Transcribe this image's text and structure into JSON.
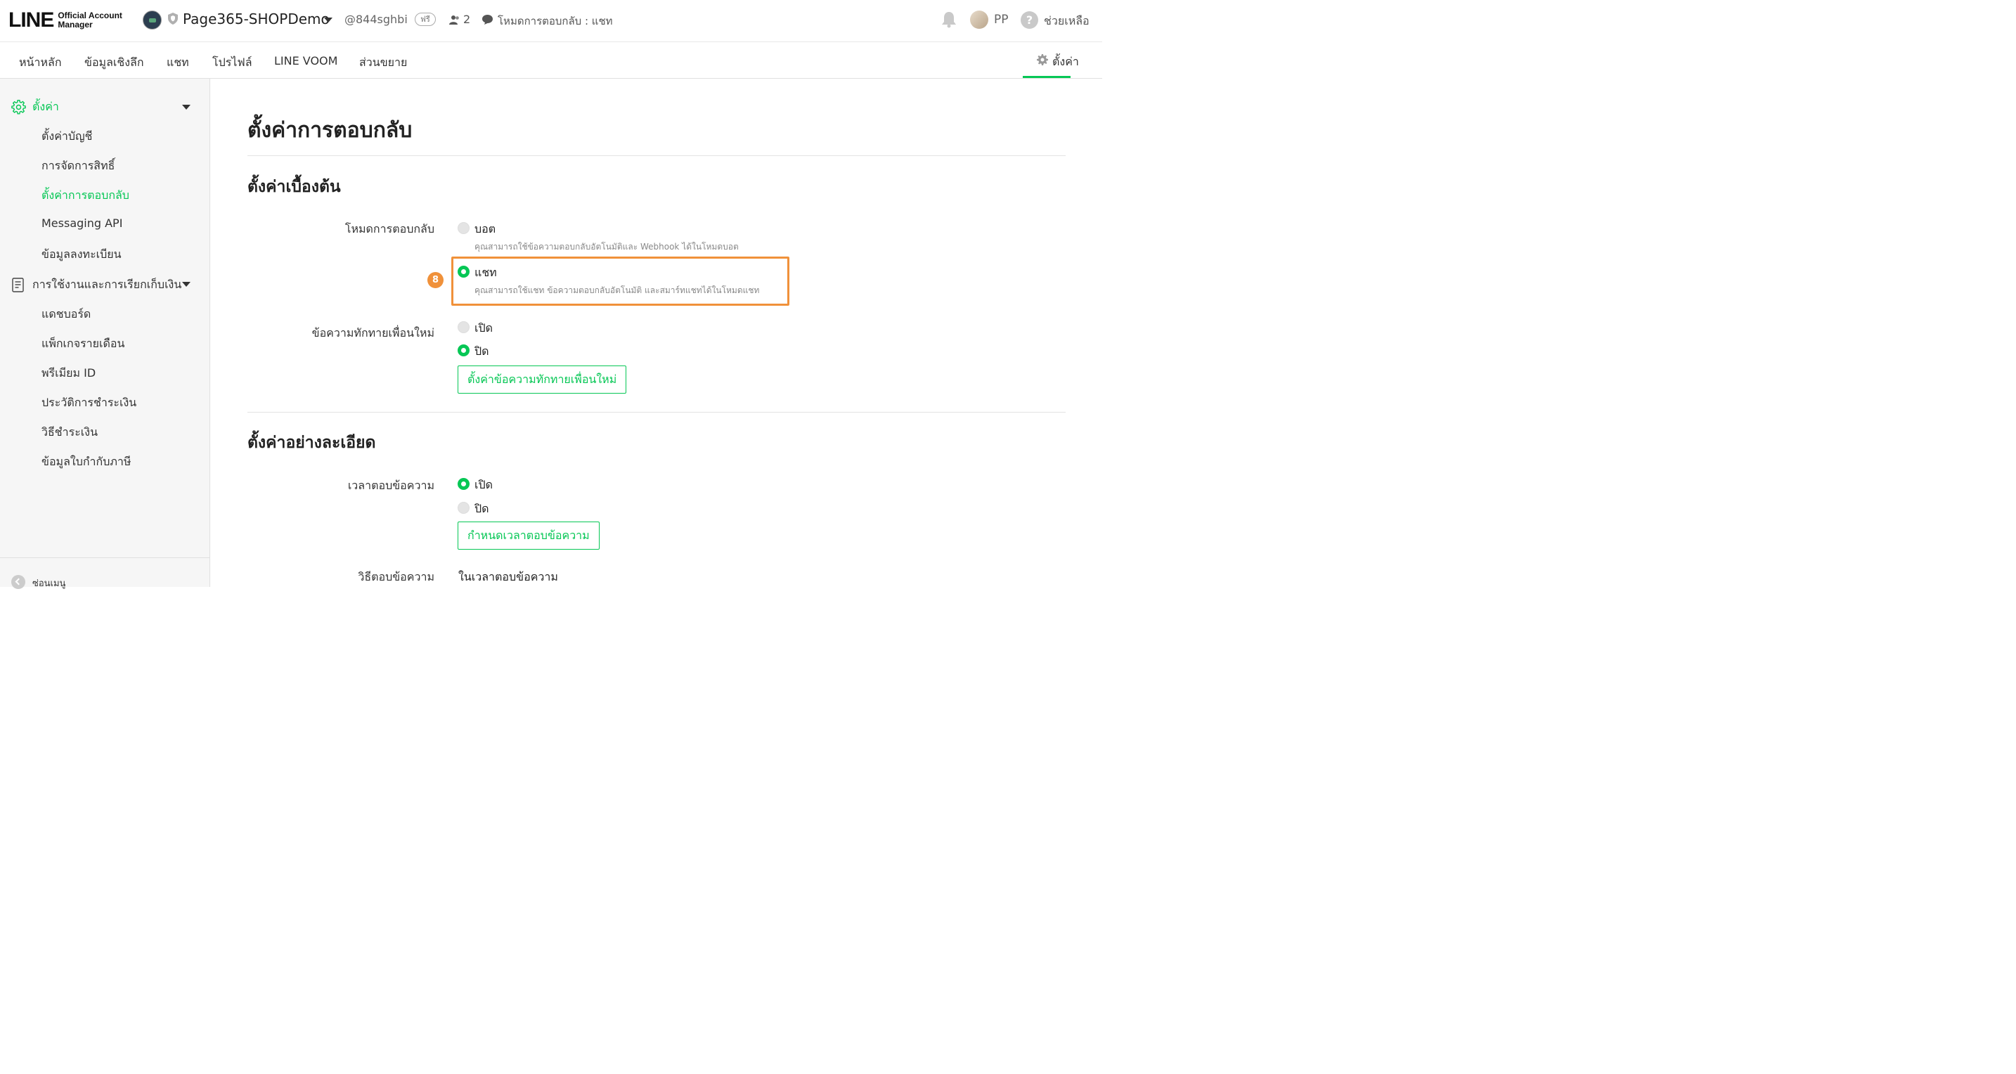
{
  "header": {
    "logo_main": "LINE",
    "logo_sub_1": "Official Account",
    "logo_sub_2": "Manager",
    "account_name": "Page365-SHOPDemo",
    "account_id": "@844sghbi",
    "plan_badge": "ฟรี",
    "friends_count": "2",
    "response_mode": "โหมดการตอบกลับ : แชท",
    "user_name": "PP",
    "help_label": "ช่วยเหลือ"
  },
  "nav": {
    "items": [
      "หน้าหลัก",
      "ข้อมูลเชิงลึก",
      "แชท",
      "โปรไฟล์",
      "LINE VOOM",
      "ส่วนขยาย"
    ],
    "settings": "ตั้งค่า"
  },
  "sidebar": {
    "settings_header": "ตั้งค่า",
    "settings_items": [
      "ตั้งค่าบัญชี",
      "การจัดการสิทธิ์",
      "ตั้งค่าการตอบกลับ",
      "Messaging API",
      "ข้อมูลลงทะเบียน"
    ],
    "billing_header": "การใช้งานและการเรียกเก็บเงิน",
    "billing_items": [
      "แดชบอร์ด",
      "แพ็กเกจรายเดือน",
      "พรีเมียม ID",
      "ประวัติการชำระเงิน",
      "วิธีชำระเงิน",
      "ข้อมูลใบกำกับภาษี"
    ],
    "collapse_label": "ซ่อนเมนู"
  },
  "main": {
    "page_title": "ตั้งค่าการตอบกลับ",
    "basic": {
      "title": "ตั้งค่าเบื้องต้น",
      "response_mode_label": "โหมดการตอบกลับ",
      "bot_option": "บอต",
      "bot_desc": "คุณสามารถใช้ข้อความตอบกลับอัตโนมัติและ Webhook ได้ในโหมดบอต",
      "chat_option": "แชท",
      "chat_desc": "คุณสามารถใช้แชท ข้อความตอบกลับอัตโนมัติ และสมาร์ทแชทได้ในโหมดแชท",
      "step_number": "8",
      "greeting_label": "ข้อความทักทายเพื่อนใหม่",
      "on": "เปิด",
      "off": "ปิด",
      "greeting_button": "ตั้งค่าข้อความทักทายเพื่อนใหม่"
    },
    "advanced": {
      "title": "ตั้งค่าอย่างละเอียด",
      "response_hours_label": "เวลาตอบข้อความ",
      "on": "เปิด",
      "off": "ปิด",
      "response_hours_button": "กำหนดเวลาตอบข้อความ",
      "response_method_label": "วิธีตอบข้อความ",
      "response_method_value": "ในเวลาตอบข้อความ"
    }
  },
  "colors": {
    "accent": "#06c755",
    "highlight": "#f0913a"
  }
}
